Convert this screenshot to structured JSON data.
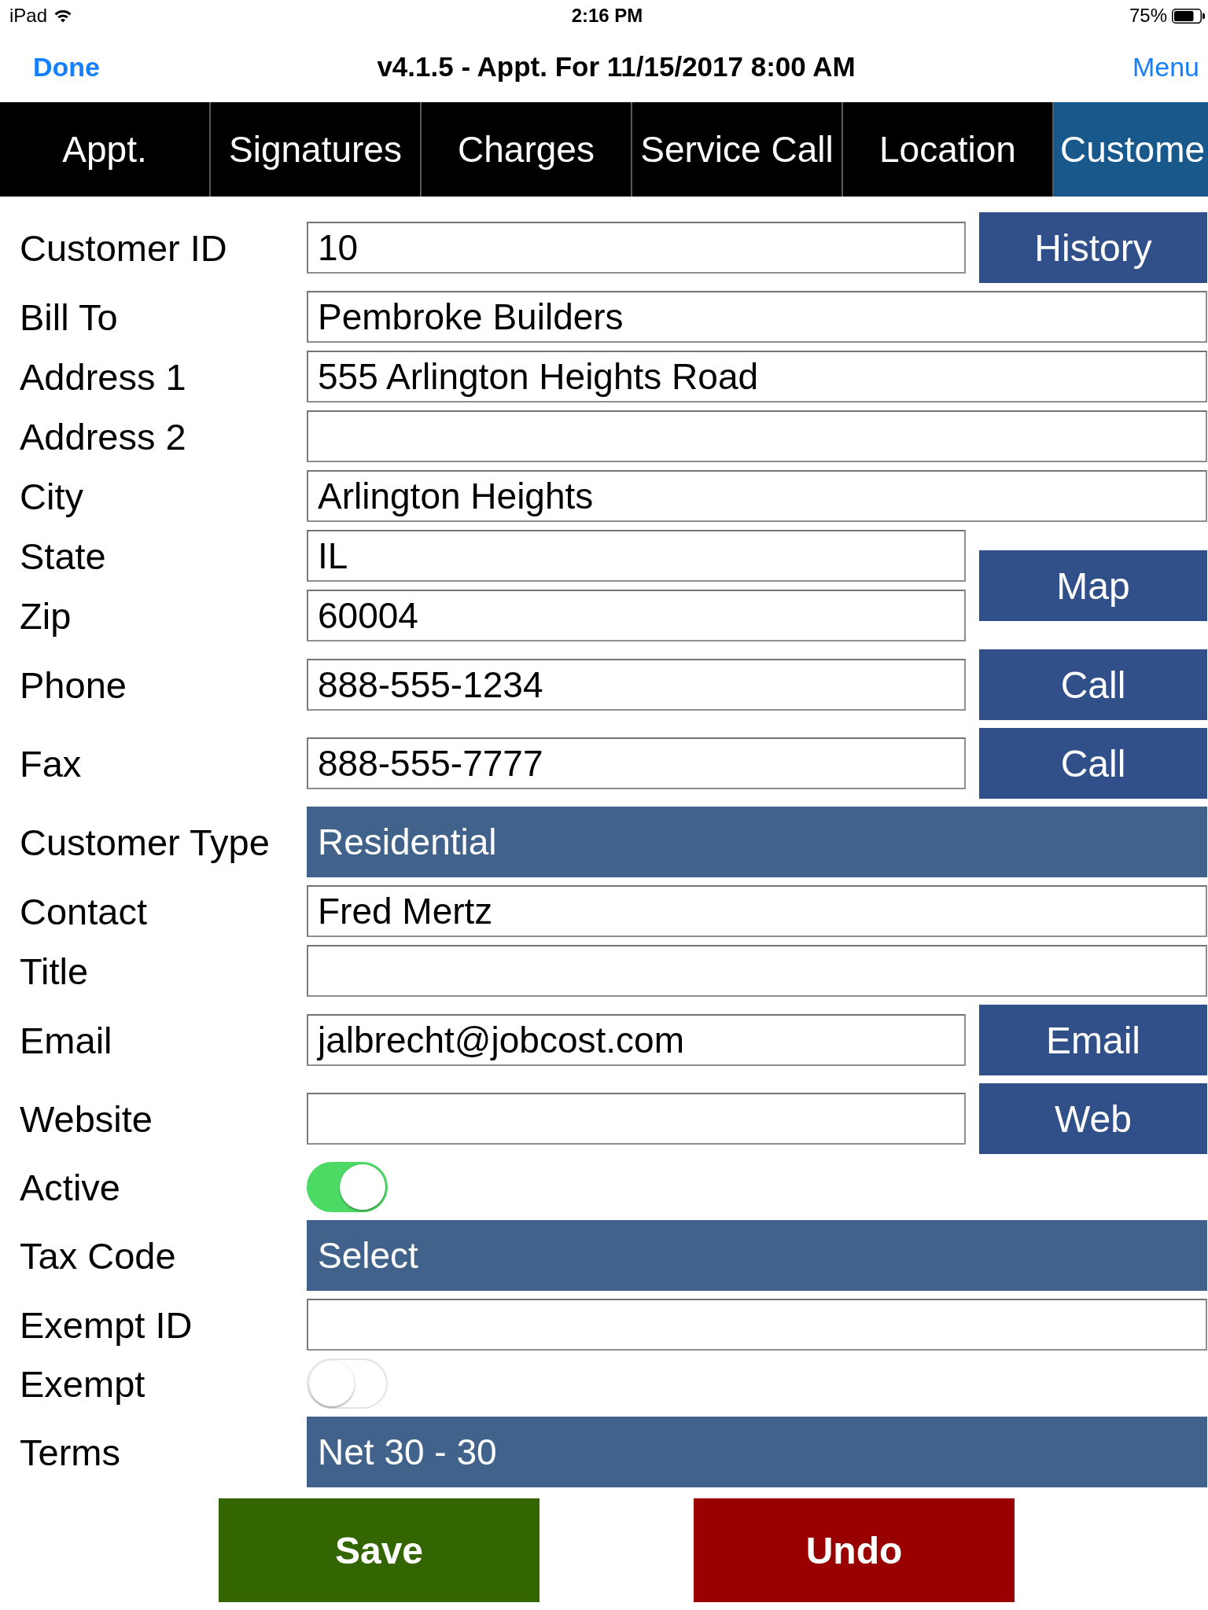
{
  "status_bar": {
    "carrier": "iPad",
    "time": "2:16 PM",
    "battery": "75%"
  },
  "nav_bar": {
    "left_button": "Done",
    "title": "v4.1.5 - Appt. For 11/15/2017 8:00 AM",
    "right_button": "Menu"
  },
  "tabs": [
    {
      "label": "Appt.",
      "selected": false
    },
    {
      "label": "Signatures",
      "selected": false
    },
    {
      "label": "Charges",
      "selected": false
    },
    {
      "label": "Service Call",
      "selected": false
    },
    {
      "label": "Location",
      "selected": false
    },
    {
      "label": "Custome",
      "selected": true
    }
  ],
  "form": {
    "groups": [
      {
        "button": "History",
        "rows": [
          {
            "label": "Customer ID",
            "kind": "text",
            "value": "10"
          }
        ]
      },
      {
        "rows": [
          {
            "label": "Bill To",
            "kind": "text",
            "value": "Pembroke Builders"
          },
          {
            "label": "Address 1",
            "kind": "text",
            "value": "555 Arlington Heights Road"
          },
          {
            "label": "Address 2",
            "kind": "text"
          },
          {
            "label": "City",
            "kind": "text",
            "value": "Arlington Heights"
          }
        ]
      },
      {
        "button": "Map",
        "rows": [
          {
            "label": "State",
            "kind": "text",
            "value": "IL"
          },
          {
            "label": "Zip",
            "kind": "text",
            "value": "60004"
          }
        ]
      },
      {
        "button": "Call",
        "rows": [
          {
            "label": "Phone",
            "kind": "text",
            "value": "888-555-1234"
          }
        ]
      },
      {
        "button": "Call",
        "rows": [
          {
            "label": "Fax",
            "kind": "text",
            "value": "888-555-7777"
          }
        ]
      },
      {
        "rows": [
          {
            "label": "Customer Type",
            "kind": "select",
            "value": "Residential"
          },
          {
            "label": "Contact",
            "kind": "text",
            "value": "Fred Mertz"
          },
          {
            "label": "Title",
            "kind": "text"
          }
        ]
      },
      {
        "button": "Email",
        "rows": [
          {
            "label": "Email",
            "kind": "text",
            "value": "jalbrecht@jobcost.com"
          }
        ]
      },
      {
        "button": "Web",
        "rows": [
          {
            "label": "Website",
            "kind": "text"
          }
        ]
      },
      {
        "rows": [
          {
            "label": "Active",
            "kind": "toggle",
            "on": true
          },
          {
            "label": "Tax Code",
            "kind": "select",
            "value": "Select"
          },
          {
            "label": "Exempt ID",
            "kind": "text"
          },
          {
            "label": "Exempt",
            "kind": "toggle",
            "on": false
          },
          {
            "label": "Terms",
            "kind": "select",
            "value": "Net 30 - 30"
          }
        ]
      }
    ]
  },
  "footer": {
    "buttons": [
      {
        "label": "Save",
        "kind": "save"
      },
      {
        "label": "Undo",
        "kind": "undo"
      }
    ]
  }
}
